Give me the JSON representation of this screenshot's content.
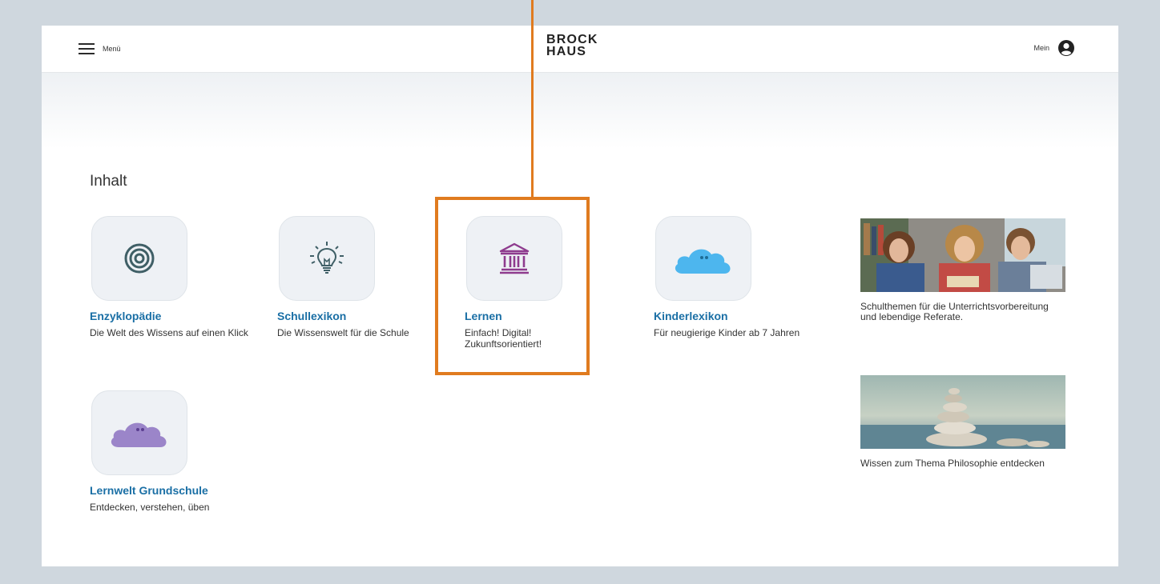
{
  "header": {
    "menu_label": "Menü",
    "logo_line1": "BROCK",
    "logo_line2": "HAUS",
    "account_label": "Mein"
  },
  "content": {
    "section_title": "Inhalt",
    "tiles": [
      {
        "title": "Enzyklopädie",
        "description": "Die Welt des Wissens auf einen Klick",
        "icon": "target-icon",
        "color": "#3f5f66"
      },
      {
        "title": "Schullexikon",
        "description": "Die Wissenswelt für die Schule",
        "icon": "lightbulb-icon",
        "color": "#3f5f66"
      },
      {
        "title": "Lernen",
        "description": "Einfach! Digital! Zukunftsorientiert!",
        "icon": "museum-icon",
        "color": "#8e3b8e"
      },
      {
        "title": "Kinderlexikon",
        "description": "Für neugierige Kinder ab 7 Jahren",
        "icon": "blue-cloud-icon",
        "color": "#4db6ee"
      },
      {
        "title": "Lernwelt Grundschule",
        "description": "Entdecken, verstehen, üben",
        "icon": "purple-cloud-icon",
        "color": "#9b85c9"
      }
    ],
    "promos": [
      {
        "text": "Schulthemen für die Unterrichtsvorbereitung und lebendige Referate.",
        "image": "students-photo"
      },
      {
        "text": "Wissen zum Thema Philosophie entdecken",
        "image": "stacked-stones-photo"
      }
    ]
  },
  "colors": {
    "accent": "#1a6fa5",
    "highlight": "#e07b1f"
  }
}
